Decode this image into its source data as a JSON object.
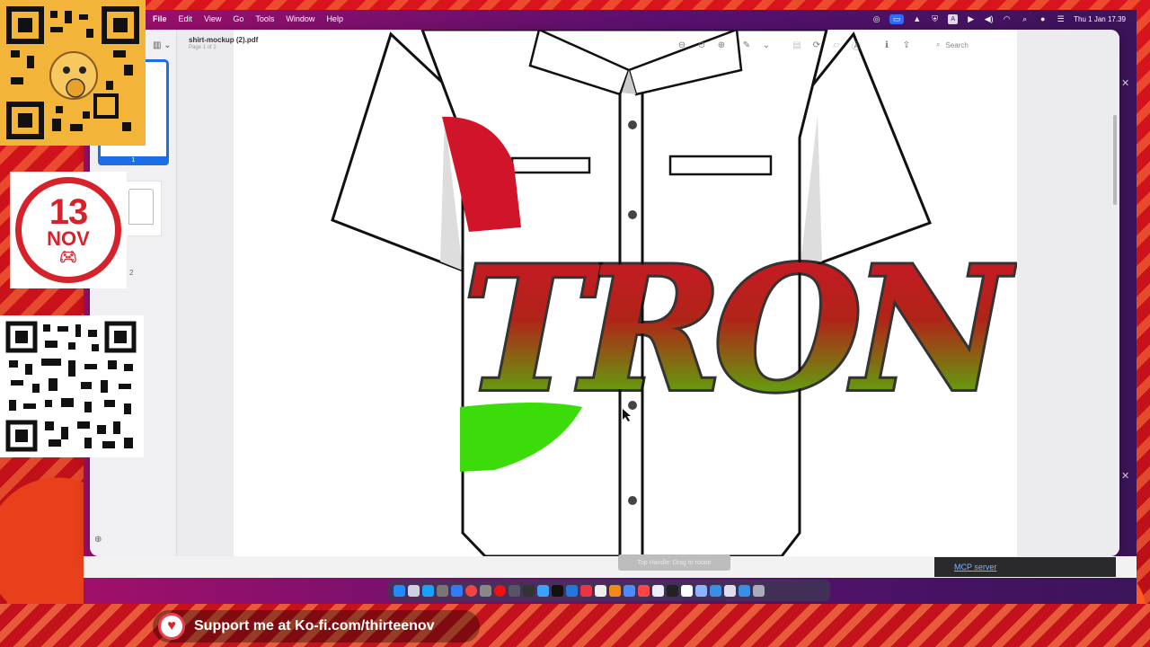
{
  "menubar": {
    "menus": [
      "File",
      "Edit",
      "View",
      "Go",
      "Tools",
      "Window",
      "Help"
    ],
    "status_icons": [
      "creative-cloud-icon",
      "screen-mirror-icon",
      "vlc-icon",
      "shield-icon",
      "text-input-icon",
      "play-icon",
      "volume-icon",
      "wifi-icon",
      "search-icon",
      "siri-icon",
      "control-center-icon"
    ],
    "clock": "Thu 1 Jan 17.39"
  },
  "preview": {
    "doc_title": "shirt-mockup (2).pdf",
    "doc_subtitle": "Page 1 of 2",
    "search_placeholder": "Search",
    "thumbnails": [
      {
        "label": "1",
        "selected": true
      },
      {
        "label": "2",
        "selected": false
      }
    ],
    "shirt_text": "TRON"
  },
  "tooltip": "Top Handle: Drag to rotate",
  "mcp_link": "MCP server",
  "overlays": {
    "badge_number": "13",
    "badge_month": "NOV",
    "kofi_text": "Support me at Ko-fi.com/thirteenov"
  },
  "colors": {
    "accent_blue": "#1b6ee6",
    "badge_red": "#d6222b",
    "tron_red": "#d0152a",
    "tron_green": "#3cdc0a"
  }
}
